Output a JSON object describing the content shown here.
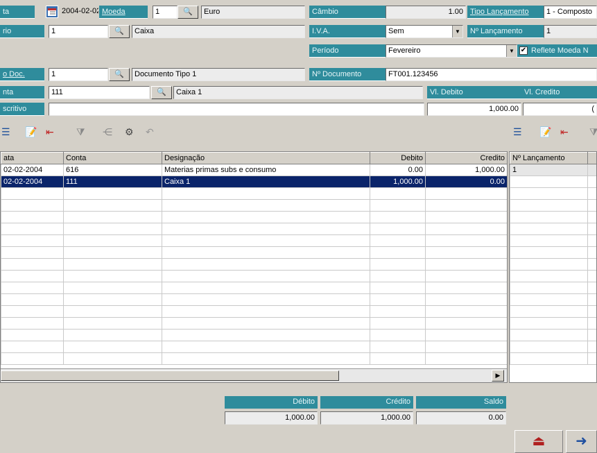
{
  "header": {
    "data_label": "ta",
    "data_value": "2004-02-02",
    "moeda_label": "Moeda",
    "moeda_code": "1",
    "moeda_name": "Euro",
    "diario_label": "rio",
    "diario_code": "1",
    "diario_name": "Caixa",
    "cambio_label": "Câmbio",
    "cambio_value": "1.00",
    "tipo_lanc_label": "Tipo Lançamento",
    "tipo_lanc_value": "1 - Composto",
    "iva_label": "I.V.A.",
    "iva_value": "Sem",
    "num_lanc_label": "Nº Lançamento",
    "num_lanc_value": "1",
    "periodo_label": "Período",
    "periodo_value": "Fevereiro",
    "reflete_label": "Reflete Moeda N"
  },
  "document": {
    "tipo_doc_label": "o Doc.",
    "tipo_doc_code": "1",
    "tipo_doc_name": "Documento Tipo 1",
    "num_doc_label": "Nº Documento",
    "num_doc_value": "FT001.123456",
    "conta_label": "nta",
    "conta_code": "111",
    "conta_name": "Caixa 1",
    "vl_debito_label": "Vl. Debito",
    "vl_credito_label": "Vl. Credito",
    "descritivo_label": "scritivo",
    "descritivo_value": "",
    "vl_debito_value": "1,000.00",
    "vl_credito_value": "("
  },
  "grid": {
    "columns": [
      "ata",
      "Conta",
      "Designação",
      "Debito",
      "Credito"
    ],
    "rows": [
      [
        "02-02-2004",
        "616",
        "Materias primas subs e consumo",
        "0.00",
        "1,000.00"
      ],
      [
        "02-02-2004",
        "111",
        "Caixa 1",
        "1,000.00",
        "0.00"
      ]
    ]
  },
  "side_grid": {
    "header": "Nº Lançamento",
    "rows": [
      "1"
    ]
  },
  "totals": {
    "debito_label": "Débito",
    "credito_label": "Crédito",
    "saldo_label": "Saldo",
    "debito_value": "1,000.00",
    "credito_value": "1,000.00",
    "saldo_value": "0.00"
  }
}
